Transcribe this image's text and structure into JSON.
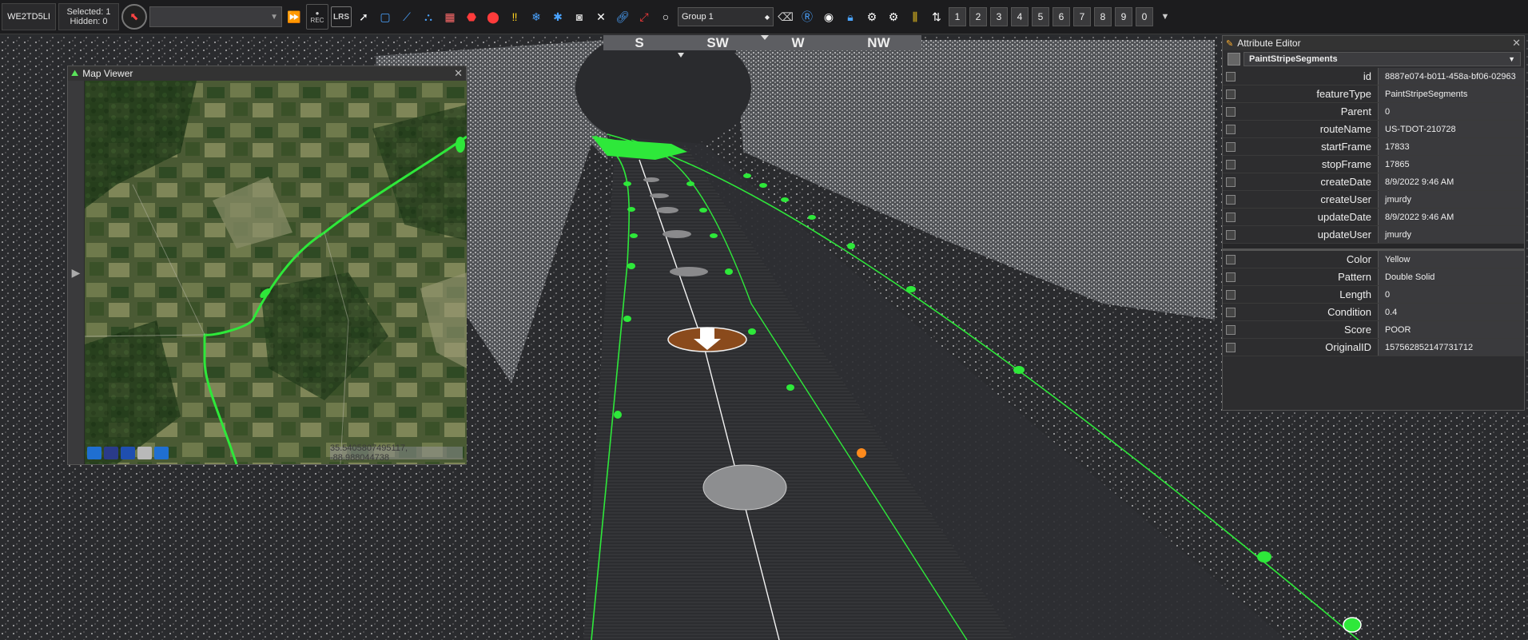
{
  "toolbar": {
    "project_name": "WE2TD5LI",
    "selected": "Selected: 1",
    "hidden": "Hidden: 0",
    "rec_label": "REC",
    "lrs_label": "LRS",
    "group_select": "Group 1",
    "numbers": [
      "1",
      "2",
      "3",
      "4",
      "5",
      "6",
      "7",
      "8",
      "9",
      "0"
    ]
  },
  "compass": {
    "labels": [
      "S",
      "SW",
      "W",
      "NW"
    ]
  },
  "map_viewer": {
    "title": "Map Viewer",
    "coordinates": "35.5405807495117, -88.988044738"
  },
  "attribute_editor": {
    "title": "Attribute Editor",
    "feature_type": "PaintStripeSegments",
    "rows": [
      {
        "key": "id",
        "value": "8887e074-b011-458a-bf06-02963"
      },
      {
        "key": "featureType",
        "value": "PaintStripeSegments"
      },
      {
        "key": "Parent",
        "value": "0"
      },
      {
        "key": "routeName",
        "value": "US-TDOT-210728"
      },
      {
        "key": "startFrame",
        "value": "17833"
      },
      {
        "key": "stopFrame",
        "value": "17865"
      },
      {
        "key": "createDate",
        "value": "8/9/2022 9:46 AM"
      },
      {
        "key": "createUser",
        "value": "jmurdy"
      },
      {
        "key": "updateDate",
        "value": "8/9/2022 9:46 AM"
      },
      {
        "key": "updateUser",
        "value": "jmurdy"
      }
    ],
    "custom_rows": [
      {
        "key": "Color",
        "value": "Yellow"
      },
      {
        "key": "Pattern",
        "value": "Double Solid"
      },
      {
        "key": "Length",
        "value": "0"
      },
      {
        "key": "Condition",
        "value": "0.4"
      },
      {
        "key": "Score",
        "value": "POOR"
      },
      {
        "key": "OriginalID",
        "value": "157562852147731712"
      }
    ]
  },
  "colors": {
    "accent_green": "#2ee83a",
    "orange_marker": "#ff8a1c",
    "selected_marker": "#8a4a1c"
  }
}
